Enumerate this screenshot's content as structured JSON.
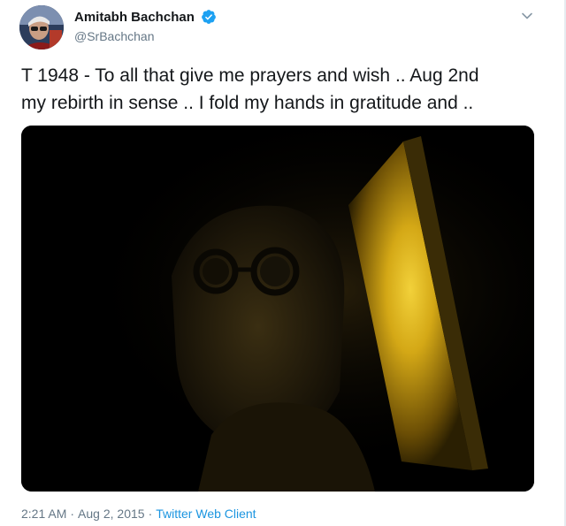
{
  "tweet": {
    "author": {
      "display_name": "Amitabh Bachchan",
      "handle": "@SrBachchan",
      "verified": true,
      "avatar_icon": "profile-photo"
    },
    "text_line1": "T 1948 - To all that give me prayers and wish .. Aug 2nd",
    "text_line2": "my rebirth in sense .. I fold my hands in gratitude and ..",
    "media": {
      "type": "photo",
      "dominant_color": "#000000",
      "light_color": "#e8c12a"
    },
    "footer": {
      "time": "2:21 AM",
      "date": "Aug 2, 2015",
      "source": "Twitter Web Client"
    },
    "menu_icon": "chevron-down-icon"
  },
  "colors": {
    "primary_text": "#14171a",
    "secondary_text": "#657786",
    "link": "#1b95e0",
    "verified_badge": "#1da1f2"
  }
}
